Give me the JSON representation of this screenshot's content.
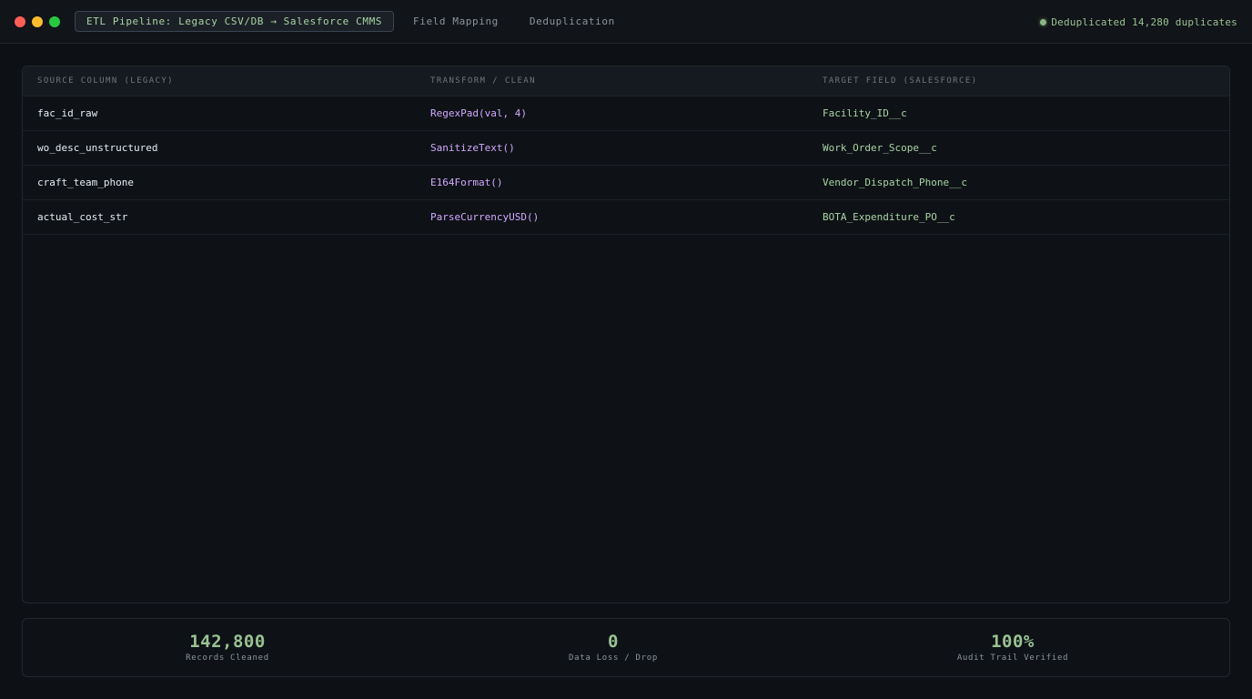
{
  "window": {
    "active_tab": "ETL Pipeline: Legacy CSV/DB → Salesforce CMMS",
    "tabs": [
      "Field Mapping",
      "Deduplication"
    ],
    "status": "Deduplicated 14,280 duplicates",
    "status_color": "#8bb583"
  },
  "table": {
    "headers": [
      "SOURCE COLUMN (LEGACY)",
      "TRANSFORM / CLEAN",
      "TARGET FIELD (SALESFORCE)"
    ],
    "rows": [
      {
        "source": "fac_id_raw",
        "transform": "RegexPad(val, 4)",
        "target": "Facility_ID__c"
      },
      {
        "source": "wo_desc_unstructured",
        "transform": "SanitizeText()",
        "target": "Work_Order_Scope__c"
      },
      {
        "source": "craft_team_phone",
        "transform": "E164Format()",
        "target": "Vendor_Dispatch_Phone__c"
      },
      {
        "source": "actual_cost_str",
        "transform": "ParseCurrencyUSD()",
        "target": "BOTA_Expenditure_PO__c"
      }
    ]
  },
  "stats": [
    {
      "value": "142,800",
      "label": "Records Cleaned"
    },
    {
      "value": "0",
      "label": "Data Loss / Drop"
    },
    {
      "value": "100%",
      "label": "Audit Trail Verified"
    }
  ],
  "colors": {
    "background": "#0d1014",
    "accent_green": "#9ac394",
    "transform_purple": "#d2a8ff"
  }
}
